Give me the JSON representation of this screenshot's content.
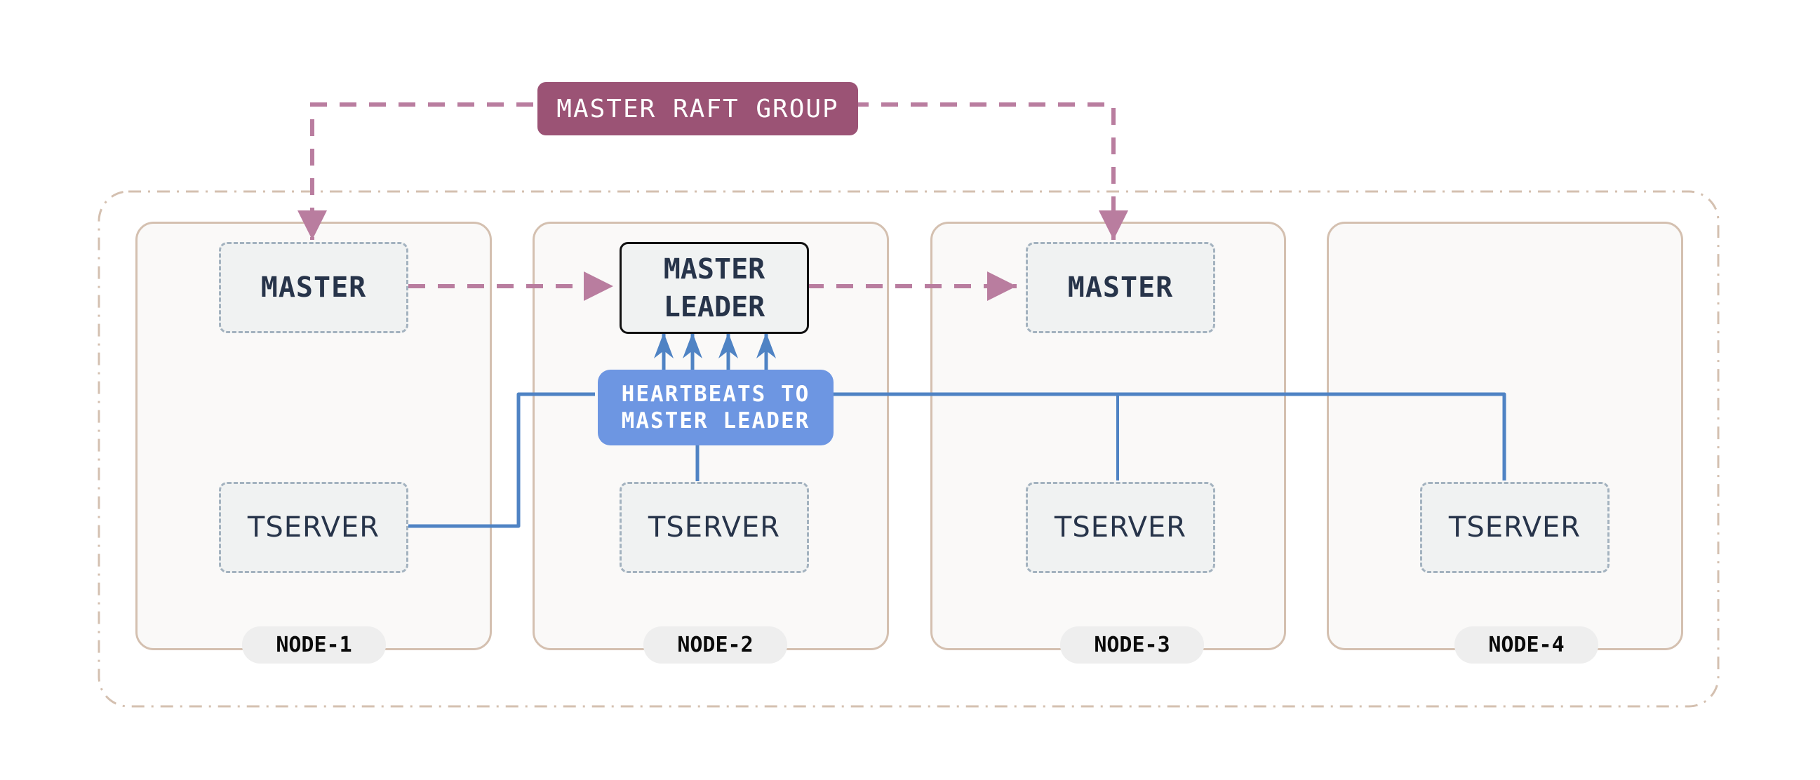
{
  "diagram": {
    "raft_group": {
      "label": "MASTER RAFT GROUP"
    },
    "heartbeats": {
      "line1": "HEARTBEATS TO",
      "line2": "MASTER LEADER"
    },
    "nodes": [
      {
        "label": "NODE-1",
        "master": "MASTER",
        "tserver": "TSERVER"
      },
      {
        "label": "NODE-2",
        "leader_line1": "MASTER",
        "leader_line2": "LEADER",
        "tserver": "TSERVER"
      },
      {
        "label": "NODE-3",
        "master": "MASTER",
        "tserver": "TSERVER"
      },
      {
        "label": "NODE-4",
        "tserver": "TSERVER"
      }
    ],
    "colors": {
      "raft": "#9b5375",
      "raft_line": "#b97d9f",
      "heartbeat_box": "#6d96e2",
      "heartbeat_line": "#4f83c4",
      "cluster_border": "#d4c0b0",
      "component_border": "#a3b2bf",
      "component_text": "#27344a"
    }
  }
}
